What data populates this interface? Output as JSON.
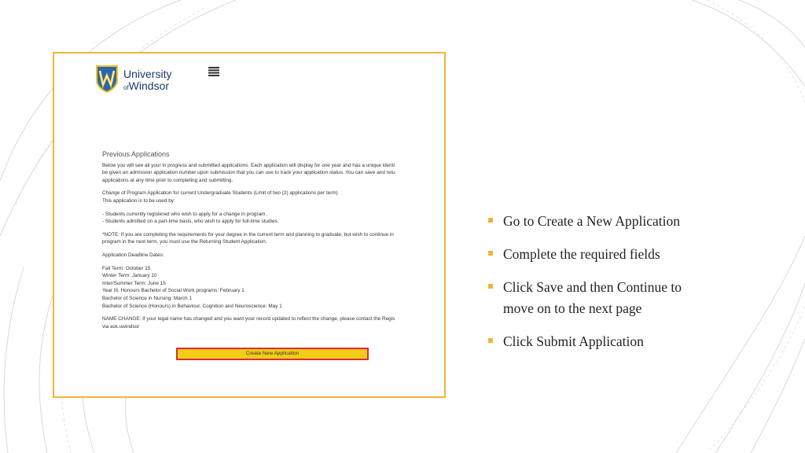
{
  "screenshot": {
    "logo": {
      "line1": "University",
      "line2_prefix": "of",
      "line2": "Windsor"
    },
    "section_title": "Previous Applications",
    "paragraphs": [
      {
        "lines": [
          "Below you will see all your in progress and submitted applications. Each application will display for one year and has a unique identi",
          "be given an admission application number upon submission that you can use to track your application status. You can save and retu",
          "applications at any time prior to completing and submitting."
        ]
      },
      {
        "lines": [
          "Change of Program Application for current Undergraduate Students (Limit of two (2) applications per term)",
          "This application is to be used by:"
        ]
      },
      {
        "lines": [
          "- Students currently registered who wish to apply for a change in program.",
          "- Students admitted on a part-time basis, who wish to apply for full-time studies."
        ]
      },
      {
        "lines": [
          "*NOTE: If you are completing the requirements for your degree in the current term and planning to graduate, but wish to continue in",
          "program in the next term, you must use the Returning Student Application."
        ]
      },
      {
        "lines": [
          "Application Deadline Dates:"
        ]
      },
      {
        "lines": [
          "Fall Term: October 15",
          "Winter Term: January 10",
          "Inter/Summer Term: June 15",
          "Year III, Honours Bachelor of Social Work programs: February 1",
          "Bachelor of Science in Nursing: March 1",
          "Bachelor of Science (Honours) in Behaviour, Cognition and Neuroscience: May 1"
        ]
      },
      {
        "lines": [
          "NAME CHANGE: If your legal name has changed and you want your record updated to reflect the change, please contact the Regis",
          "via ask.uwindsor"
        ]
      }
    ],
    "create_button_label": "Create New Application"
  },
  "bullets": [
    {
      "lines": [
        "Go to Create a New Application"
      ]
    },
    {
      "lines": [
        "Complete the required fields"
      ]
    },
    {
      "lines": [
        "Click Save and then Continue to",
        "move on to the next page"
      ]
    },
    {
      "lines": [
        "Click Submit Application"
      ]
    }
  ],
  "colors": {
    "accent": "#f0b43c",
    "button_fill": "#f2cc18",
    "button_border": "#d73030",
    "logo_blue": "#1c3a6b"
  }
}
